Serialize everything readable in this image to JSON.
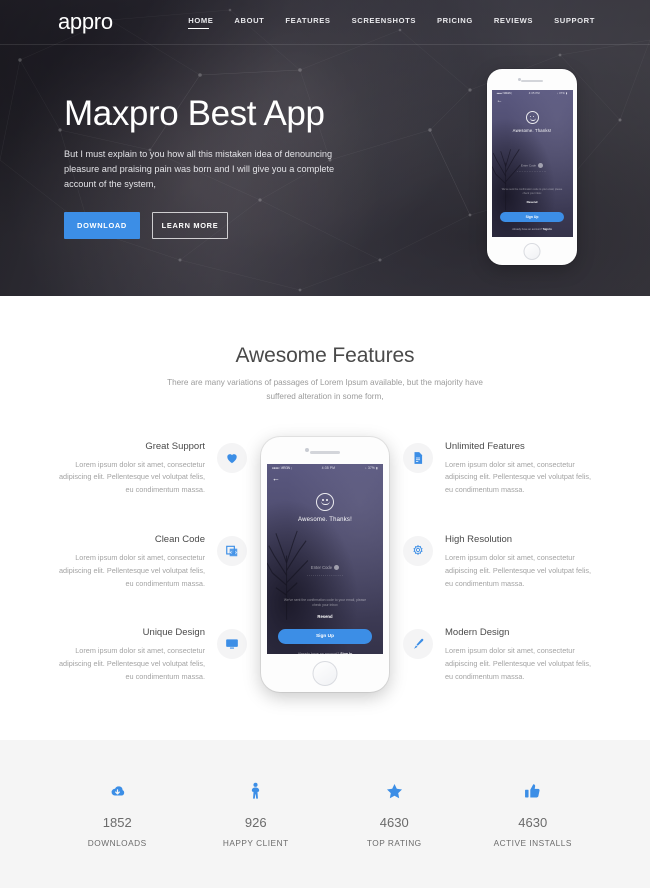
{
  "header": {
    "logo": "appro",
    "nav": [
      {
        "label": "HOME",
        "active": true
      },
      {
        "label": "ABOUT",
        "active": false
      },
      {
        "label": "FEATURES",
        "active": false
      },
      {
        "label": "SCREENSHOTS",
        "active": false
      },
      {
        "label": "PRICING",
        "active": false
      },
      {
        "label": "REVIEWS",
        "active": false
      },
      {
        "label": "SUPPORT",
        "active": false
      }
    ]
  },
  "hero": {
    "title": "Maxpro Best App",
    "subtitle": "But I must explain to you how all this mistaken idea of denouncing pleasure and praising pain was born and I will give you a complete account of the system,",
    "primary_button": "DOWNLOAD",
    "secondary_button": "LEARN MORE"
  },
  "phone_screen": {
    "status_carrier": "●●●●○ VIRGIN ↨",
    "status_time": "4:35 PM",
    "status_battery": "↓ 37% ▮",
    "heading": "Awesome. Thanks!",
    "code_placeholder": "Enter Code",
    "code_dots": "··················",
    "hint": "We've sent the confirmation code to your email, please check your inbox",
    "resend": "Resend",
    "signup_button": "Sign Up",
    "have_account": "Already have an account?",
    "signin_link": "Sign In"
  },
  "features": {
    "title": "Awesome Features",
    "subtitle": "There are many variations of passages of Lorem Ipsum available, but the majority have suffered alteration in some form,",
    "body_text": "Lorem ipsum dolor sit amet, consectetur adipiscing elit. Pellentesque vel volutpat felis, eu condimentum massa.",
    "left": [
      {
        "title": "Great Support",
        "icon": "heart-icon"
      },
      {
        "title": "Clean Code",
        "icon": "code-window-icon"
      },
      {
        "title": "Unique Design",
        "icon": "monitor-icon"
      }
    ],
    "right": [
      {
        "title": "Unlimited Features",
        "icon": "document-icon"
      },
      {
        "title": "High Resolution",
        "icon": "gear-icon"
      },
      {
        "title": "Modern Design",
        "icon": "brush-icon"
      }
    ]
  },
  "stats": [
    {
      "value": "1852",
      "label": "DOWNLOADS",
      "icon": "cloud-download-icon"
    },
    {
      "value": "926",
      "label": "HAPPY CLIENT",
      "icon": "person-icon"
    },
    {
      "value": "4630",
      "label": "TOP RATING",
      "icon": "star-icon"
    },
    {
      "value": "4630",
      "label": "ACTIVE INSTALLS",
      "icon": "thumbs-up-icon"
    }
  ],
  "colors": {
    "accent": "#3c8ee6",
    "hero_bg": "#3b3a42",
    "stats_bg": "#f5f5f5",
    "text_dark": "#4a4a4a",
    "text_muted": "#a3a3a3"
  }
}
